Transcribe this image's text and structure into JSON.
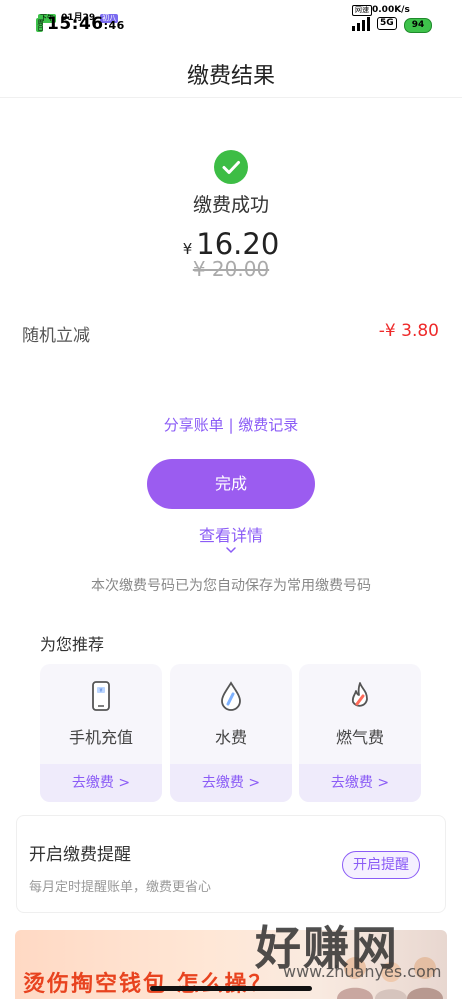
{
  "status_bar": {
    "period": "下午",
    "date": "01月29",
    "lunar": "初八",
    "weekday": "周日",
    "time": "15:46",
    "seconds": ":46",
    "net_label": "网速",
    "net_speed": "0.00K/s",
    "network": "5G",
    "battery": "94"
  },
  "header": {
    "title": "缴费结果"
  },
  "result": {
    "status_text": "缴费成功",
    "currency": "¥",
    "amount": "16.20",
    "original_amount": "¥ 20.00",
    "discount_label": "随机立减",
    "discount_value": "-¥ 3.80"
  },
  "links": {
    "share_bill": "分享账单",
    "separator": " | ",
    "pay_records": "缴费记录"
  },
  "done_button": "完成",
  "view_details": "查看详情",
  "autosave_note": "本次缴费号码已为您自动保存为常用缴费号码",
  "recommend": {
    "title": "为您推荐",
    "items": [
      {
        "label": "手机充值",
        "action": "去缴费 >",
        "icon": "phone-recharge-icon"
      },
      {
        "label": "水费",
        "action": "去缴费 >",
        "icon": "water-drop-icon"
      },
      {
        "label": "燃气费",
        "action": "去缴费 >",
        "icon": "gas-flame-icon"
      }
    ]
  },
  "reminder": {
    "title": "开启缴费提醒",
    "subtitle": "每月定时提醒账单，缴费更省心",
    "button": "开启提醒"
  },
  "banner": {
    "text": "烫伤掏空钱包 怎么操？"
  },
  "watermark": {
    "text": "好赚网",
    "url": "www.zhuanyes.com"
  },
  "colors": {
    "accent": "#9b5cf0",
    "link": "#8b5cf6",
    "success": "#3dbd45",
    "discount": "#ee2a2a"
  }
}
